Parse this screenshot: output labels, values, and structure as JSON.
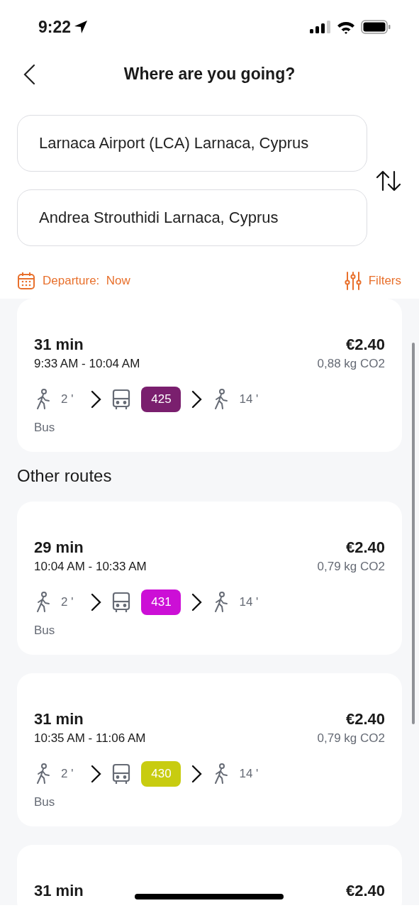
{
  "status_bar": {
    "time": "9:22"
  },
  "header": {
    "title": "Where are you going?"
  },
  "from_field": {
    "value": "Larnaca Airport (LCA) Larnaca, Cyprus"
  },
  "to_field": {
    "value": "Andrea Strouthidi Larnaca, Cyprus"
  },
  "departure": {
    "label": "Departure:",
    "value": "Now"
  },
  "filters": {
    "label": "Filters"
  },
  "best_route": {
    "duration": "31 min",
    "times": "9:33 AM - 10:04 AM",
    "price": "€2.40",
    "co2": "0,88  kg CO2",
    "mode": "Bus",
    "legs": [
      {
        "kind": "walk",
        "text": "2 '"
      },
      {
        "kind": "bus",
        "line": "425",
        "color": "#7a1f6e"
      },
      {
        "kind": "walk",
        "text": "14 '"
      }
    ]
  },
  "other_routes": {
    "title": "Other routes",
    "routes": [
      {
        "duration": "29 min",
        "times": "10:04 AM - 10:33 AM",
        "price": "€2.40",
        "co2": "0,79  kg CO2",
        "mode": "Bus",
        "legs": [
          {
            "kind": "walk",
            "text": "2 '"
          },
          {
            "kind": "bus",
            "line": "431",
            "color": "#cc0fd6"
          },
          {
            "kind": "walk",
            "text": "14 '"
          }
        ]
      },
      {
        "duration": "31 min",
        "times": "10:35 AM - 11:06 AM",
        "price": "€2.40",
        "co2": "0,79  kg CO2",
        "mode": "Bus",
        "legs": [
          {
            "kind": "walk",
            "text": "2 '"
          },
          {
            "kind": "bus",
            "line": "430",
            "color": "#c8cc10"
          },
          {
            "kind": "walk",
            "text": "14 '"
          }
        ]
      },
      {
        "duration": "31 min",
        "price": "€2.40"
      }
    ]
  }
}
